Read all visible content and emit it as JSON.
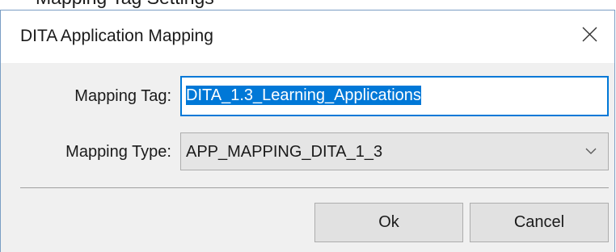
{
  "background": {
    "clipped_text": "Mapping Tag Settings"
  },
  "dialog": {
    "title": "DITA Application Mapping",
    "close_glyph": "×",
    "mapping_tag": {
      "label": "Mapping Tag:",
      "value": "DITA_1.3_Learning_Applications"
    },
    "mapping_type": {
      "label": "Mapping Type:",
      "value": "APP_MAPPING_DITA_1_3"
    },
    "buttons": {
      "ok": "Ok",
      "cancel": "Cancel"
    }
  },
  "colors": {
    "accent": "#0078d7",
    "dialog_bg": "#f0f0f0",
    "button_bg": "#e1e1e1"
  },
  "icons": {
    "close": "close-icon",
    "dropdown": "chevron-down-icon"
  }
}
